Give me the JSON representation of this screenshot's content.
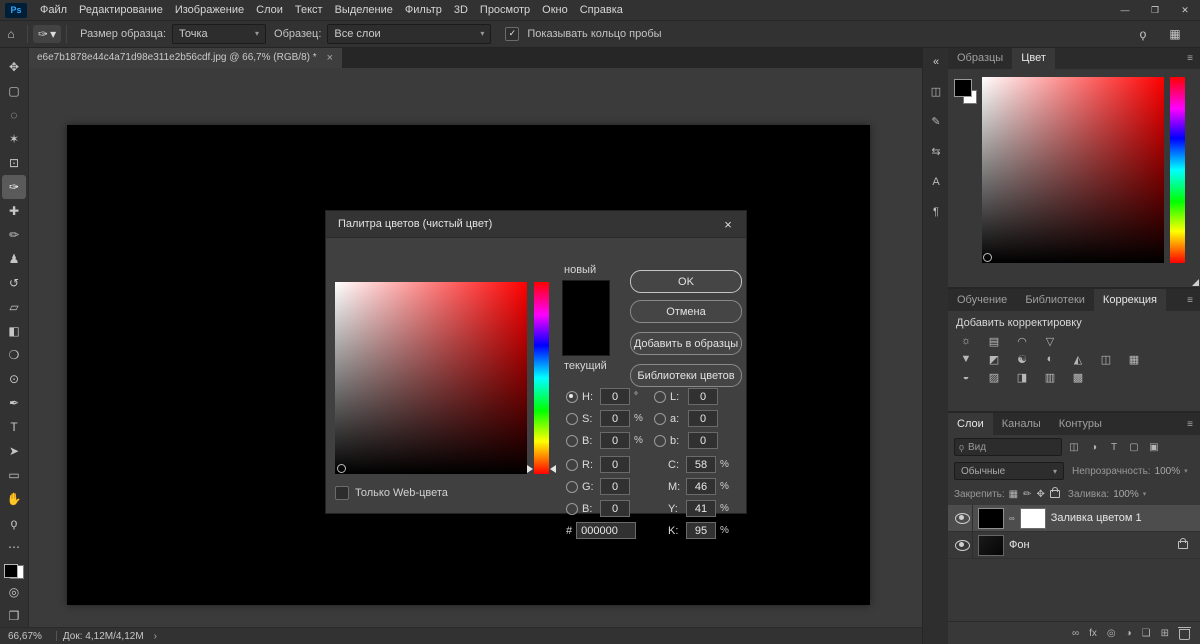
{
  "titlebar": {
    "logo": "Ps",
    "menus": [
      "Файл",
      "Редактирование",
      "Изображение",
      "Слои",
      "Текст",
      "Выделение",
      "Фильтр",
      "3D",
      "Просмотр",
      "Окно",
      "Справка"
    ],
    "window_controls": [
      "—",
      "❐",
      "✕"
    ]
  },
  "options": {
    "sample_size_label": "Размер образца:",
    "sample_size_value": "Точка",
    "sample_label": "Образец:",
    "sample_value": "Все слои",
    "probe_ring_label": "Показывать кольцо пробы"
  },
  "document_tab": {
    "title": "e6e7b1878e44c4a71d98e311e2b56cdf.jpg @ 66,7% (RGB/8) *",
    "close": "×"
  },
  "icons": {
    "home": "⌂",
    "eyedropper": "✑",
    "caret": "▾",
    "check": "✓",
    "search": "ϙ",
    "workspace": "▦",
    "panel_menu": "≡",
    "collapse": "«",
    "chevron_right": "›",
    "ellipsis": "⋯",
    "quick_mask": "◎",
    "screen_mode": "❐",
    "link": "∞"
  },
  "tools": [
    {
      "name": "move-tool",
      "glyph": "✥"
    },
    {
      "name": "marquee-tool",
      "glyph": "▢"
    },
    {
      "name": "lasso-tool",
      "glyph": "◌"
    },
    {
      "name": "magic-wand-tool",
      "glyph": "✶"
    },
    {
      "name": "crop-tool",
      "glyph": "⊡"
    },
    {
      "name": "eyedropper-tool",
      "glyph": "✑"
    },
    {
      "name": "healing-brush-tool",
      "glyph": "✚"
    },
    {
      "name": "brush-tool",
      "glyph": "✏"
    },
    {
      "name": "clone-stamp-tool",
      "glyph": "♟"
    },
    {
      "name": "history-brush-tool",
      "glyph": "↺"
    },
    {
      "name": "eraser-tool",
      "glyph": "▱"
    },
    {
      "name": "gradient-tool",
      "glyph": "◧"
    },
    {
      "name": "blur-tool",
      "glyph": "❍"
    },
    {
      "name": "dodge-tool",
      "glyph": "⊙"
    },
    {
      "name": "pen-tool",
      "glyph": "✒"
    },
    {
      "name": "type-tool",
      "glyph": "T"
    },
    {
      "name": "path-selection-tool",
      "glyph": "➤"
    },
    {
      "name": "shape-tool",
      "glyph": "▭"
    },
    {
      "name": "hand-tool",
      "glyph": "✋"
    },
    {
      "name": "zoom-tool",
      "glyph": "ϙ"
    }
  ],
  "right_rail": [
    {
      "name": "collapse-panels-icon",
      "glyph": "«"
    },
    {
      "name": "properties-panel-icon",
      "glyph": "◫"
    },
    {
      "name": "brush-settings-panel-icon",
      "glyph": "✎"
    },
    {
      "name": "clone-source-panel-icon",
      "glyph": "⇆"
    },
    {
      "name": "character-panel-icon",
      "glyph": "А"
    },
    {
      "name": "paragraph-panel-icon",
      "glyph": "¶"
    }
  ],
  "color_panel": {
    "tabs": [
      "Образцы",
      "Цвет"
    ]
  },
  "adjustments_panel": {
    "tabs": [
      "Обучение",
      "Библиотеки",
      "Коррекция"
    ],
    "title": "Добавить корректировку",
    "rows": [
      [
        {
          "name": "brightness-contrast",
          "glyph": "☼"
        },
        {
          "name": "levels",
          "glyph": "▤"
        },
        {
          "name": "curves",
          "glyph": "◠"
        },
        {
          "name": "exposure",
          "glyph": "▽"
        }
      ],
      [
        {
          "name": "vibrance",
          "glyph": "▼"
        },
        {
          "name": "hue-saturation",
          "glyph": "◩"
        },
        {
          "name": "color-balance",
          "glyph": "☯"
        },
        {
          "name": "black-white",
          "glyph": "◐"
        },
        {
          "name": "photo-filter",
          "glyph": "◭"
        },
        {
          "name": "channel-mixer",
          "glyph": "◫"
        },
        {
          "name": "color-lookup",
          "glyph": "▦"
        }
      ],
      [
        {
          "name": "invert",
          "glyph": "◒"
        },
        {
          "name": "posterize",
          "glyph": "▨"
        },
        {
          "name": "threshold",
          "glyph": "◨"
        },
        {
          "name": "gradient-map",
          "glyph": "▥"
        },
        {
          "name": "selective-color",
          "glyph": "▩"
        }
      ]
    ]
  },
  "layers_panel": {
    "tabs": [
      "Слои",
      "Каналы",
      "Контуры"
    ],
    "filter_label": "Вид",
    "filter_icons": [
      {
        "name": "filter-pixel-layers-icon",
        "glyph": "◫"
      },
      {
        "name": "filter-adjustment-layers-icon",
        "glyph": "◑"
      },
      {
        "name": "filter-type-layers-icon",
        "glyph": "T"
      },
      {
        "name": "filter-shape-layers-icon",
        "glyph": "▢"
      },
      {
        "name": "filter-smart-objects-icon",
        "glyph": "▣"
      }
    ],
    "blend_mode": "Обычные",
    "opacity_label": "Непрозрачность:",
    "opacity_value": "100%",
    "lock_label": "Закрепить:",
    "lock_icons": [
      {
        "name": "lock-transparency-icon",
        "glyph": "▦"
      },
      {
        "name": "lock-pixels-icon",
        "glyph": "✏"
      },
      {
        "name": "lock-position-icon",
        "glyph": "✥"
      }
    ],
    "fill_label": "Заливка:",
    "fill_value": "100%",
    "layers": [
      {
        "name": "Заливка цветом 1"
      },
      {
        "name": "Фон"
      }
    ],
    "footer_icons": [
      {
        "name": "link-layers-icon",
        "glyph": "∞"
      },
      {
        "name": "layer-style-icon",
        "glyph": "fx"
      },
      {
        "name": "add-mask-icon",
        "glyph": "◎"
      },
      {
        "name": "new-adjustment-layer-icon",
        "glyph": "◑"
      },
      {
        "name": "new-group-icon",
        "glyph": "❏"
      },
      {
        "name": "new-layer-icon",
        "glyph": "⊞"
      }
    ]
  },
  "color_picker": {
    "title": "Палитра цветов (чистый цвет)",
    "close": "×",
    "new_label": "новый",
    "current_label": "текущий",
    "buttons": {
      "ok": "OK",
      "cancel": "Отмена",
      "add": "Добавить в образцы",
      "libraries": "Библиотеки цветов"
    },
    "web_only": "Только Web-цвета",
    "hex_label": "#",
    "hex_value": "000000",
    "fields": {
      "h": {
        "label": "H:",
        "value": "0",
        "unit": "°"
      },
      "s": {
        "label": "S:",
        "value": "0",
        "unit": "%"
      },
      "b": {
        "label": "B:",
        "value": "0",
        "unit": "%"
      },
      "r": {
        "label": "R:",
        "value": "0"
      },
      "g": {
        "label": "G:",
        "value": "0"
      },
      "b2": {
        "label": "B:",
        "value": "0"
      },
      "l": {
        "label": "L:",
        "value": "0"
      },
      "a": {
        "label": "a:",
        "value": "0"
      },
      "lab_b": {
        "label": "b:",
        "value": "0"
      },
      "c": {
        "label": "C:",
        "value": "58",
        "unit": "%"
      },
      "m": {
        "label": "M:",
        "value": "46",
        "unit": "%"
      },
      "y": {
        "label": "Y:",
        "value": "41",
        "unit": "%"
      },
      "k": {
        "label": "K:",
        "value": "95",
        "unit": "%"
      }
    }
  },
  "statusbar": {
    "zoom": "66,67%",
    "doc": "Док: 4,12M/4,12M"
  }
}
